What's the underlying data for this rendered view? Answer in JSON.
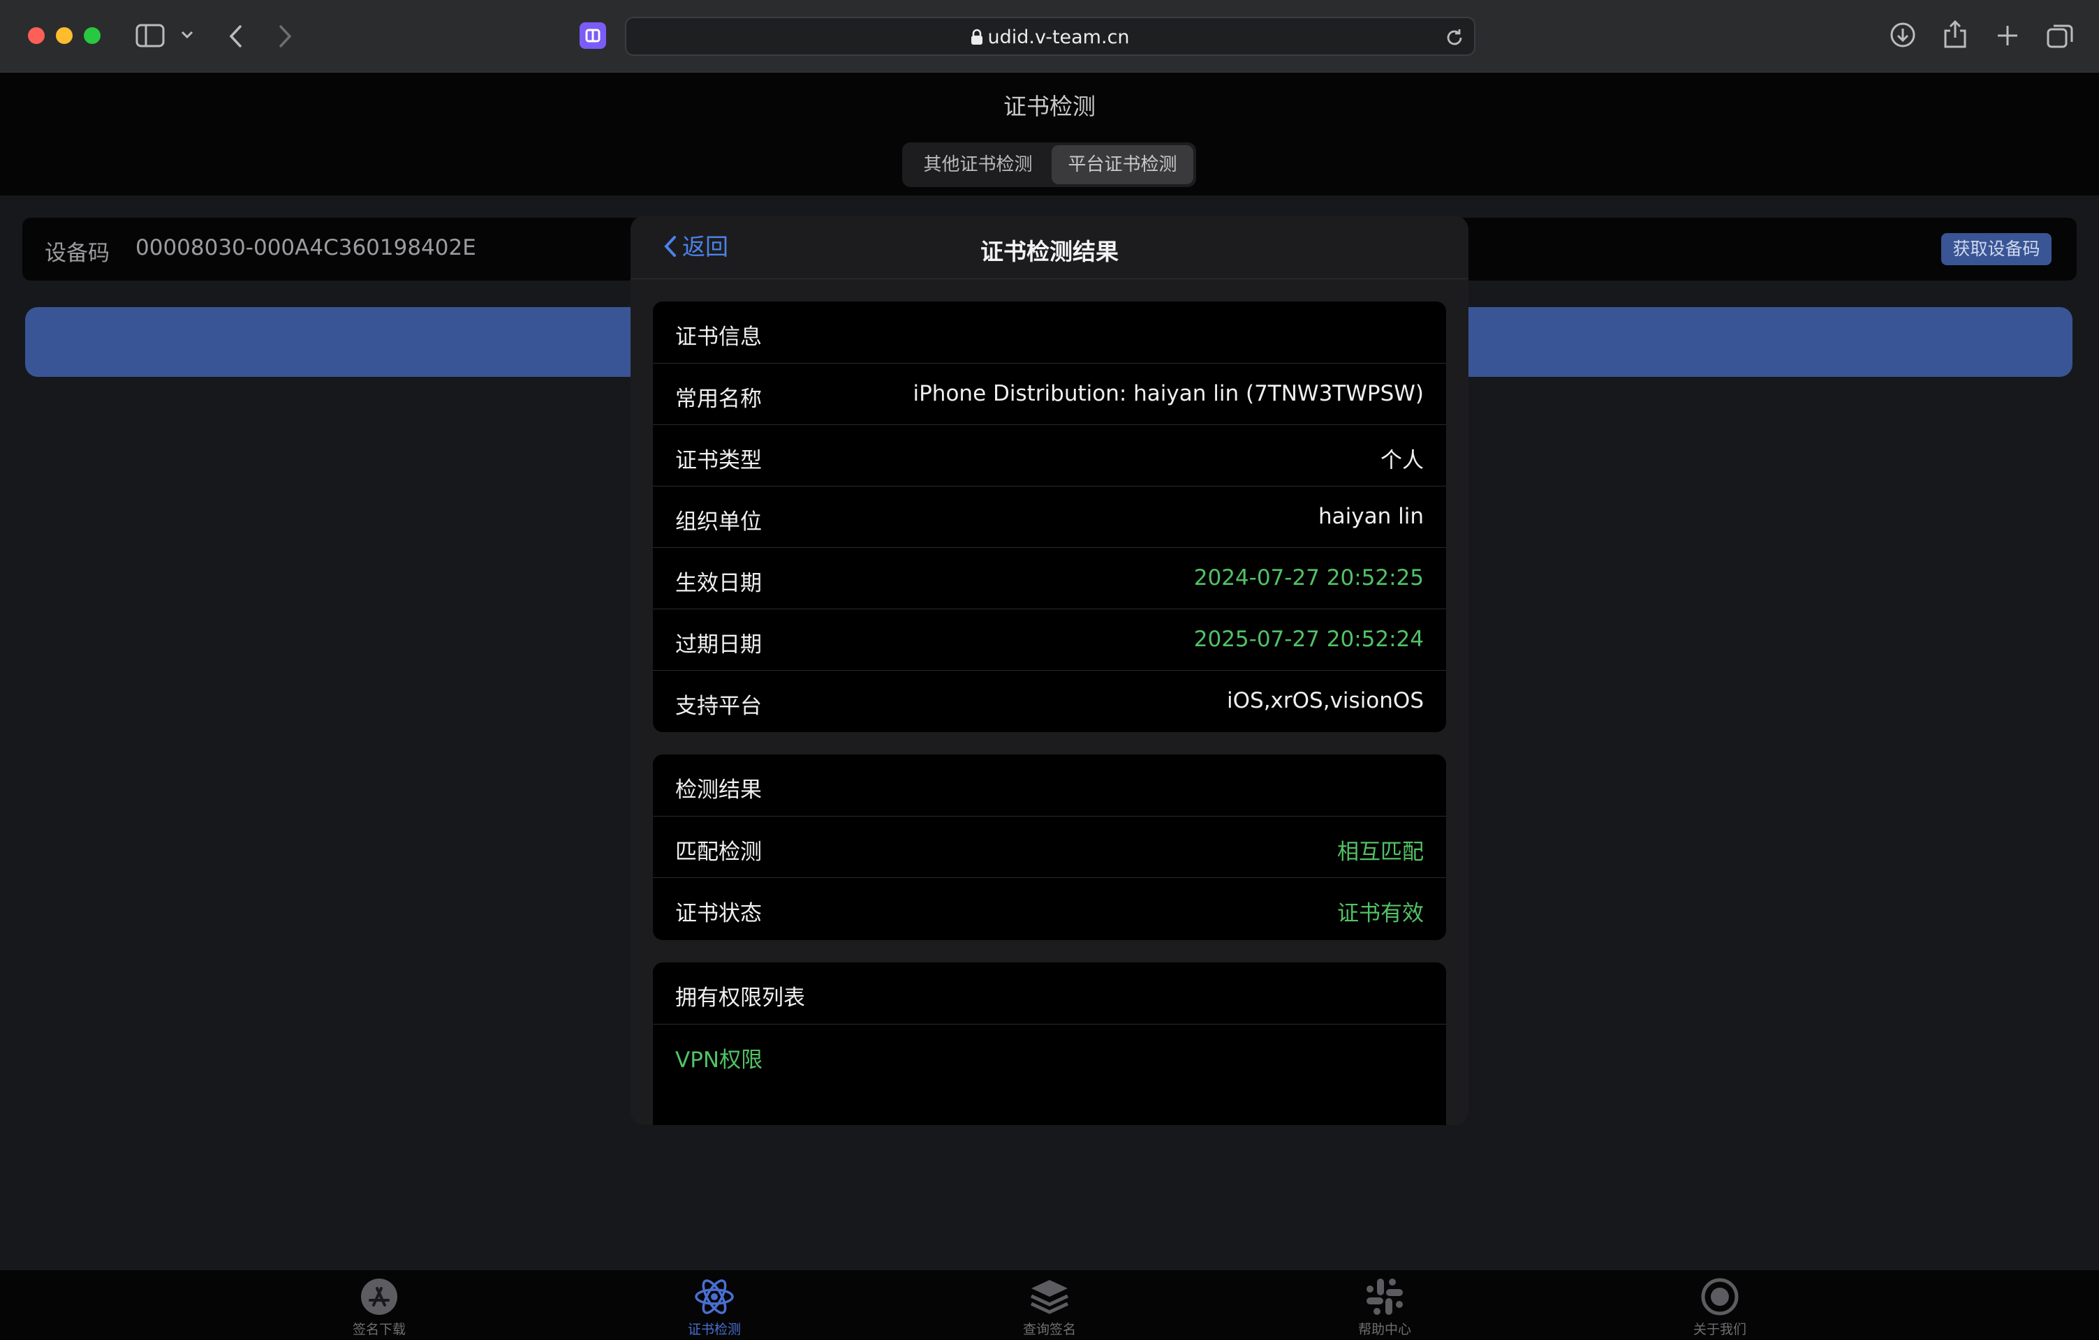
{
  "browser": {
    "url": "udid.v-team.cn",
    "colors": {
      "close": "#fe5f57",
      "minimize": "#febc2e",
      "maximize": "#28c840",
      "extension": "#7b5cf6"
    },
    "icons": [
      "sidebar-icon",
      "chevron-down-icon",
      "back-arrow-icon",
      "forward-arrow-icon",
      "lock-icon",
      "reload-icon",
      "download-icon",
      "share-icon",
      "new-tab-icon",
      "tabs-overview-icon"
    ]
  },
  "page": {
    "title": "证书检测",
    "segments": [
      {
        "label": "其他证书检测",
        "selected": false
      },
      {
        "label": "平台证书检测",
        "selected": true
      }
    ],
    "device": {
      "label": "设备码",
      "value": "00008030-000A4C360198402E",
      "button": "获取设备码"
    }
  },
  "modal": {
    "back_label": "返回",
    "title": "证书检测结果",
    "cert_info": {
      "header": "证书信息",
      "rows": [
        {
          "label": "常用名称",
          "value": "iPhone Distribution: haiyan lin (7TNW3TWPSW)"
        },
        {
          "label": "证书类型",
          "value": "个人"
        },
        {
          "label": "组织单位",
          "value": "haiyan lin"
        },
        {
          "label": "生效日期",
          "value": "2024-07-27 20:52:25"
        },
        {
          "label": "过期日期",
          "value": "2025-07-27 20:52:24"
        },
        {
          "label": "支持平台",
          "value": "iOS,xrOS,visionOS"
        }
      ]
    },
    "check_result": {
      "header": "检测结果",
      "rows": [
        {
          "label": "匹配检测",
          "value": "相互匹配"
        },
        {
          "label": "证书状态",
          "value": "证书有效"
        }
      ]
    },
    "permissions": {
      "header": "拥有权限列表",
      "items": [
        "VPN权限"
      ]
    }
  },
  "tabbar": {
    "tabs": [
      {
        "label": "签名下载",
        "icon": "app-store-icon",
        "active": false
      },
      {
        "label": "证书检测",
        "icon": "atom-icon",
        "active": true
      },
      {
        "label": "查询签名",
        "icon": "layers-icon",
        "active": false
      },
      {
        "label": "帮助中心",
        "icon": "slack-icon",
        "active": false
      },
      {
        "label": "关于我们",
        "icon": "target-icon",
        "active": false
      }
    ],
    "active_color": "#4a6fd1"
  }
}
